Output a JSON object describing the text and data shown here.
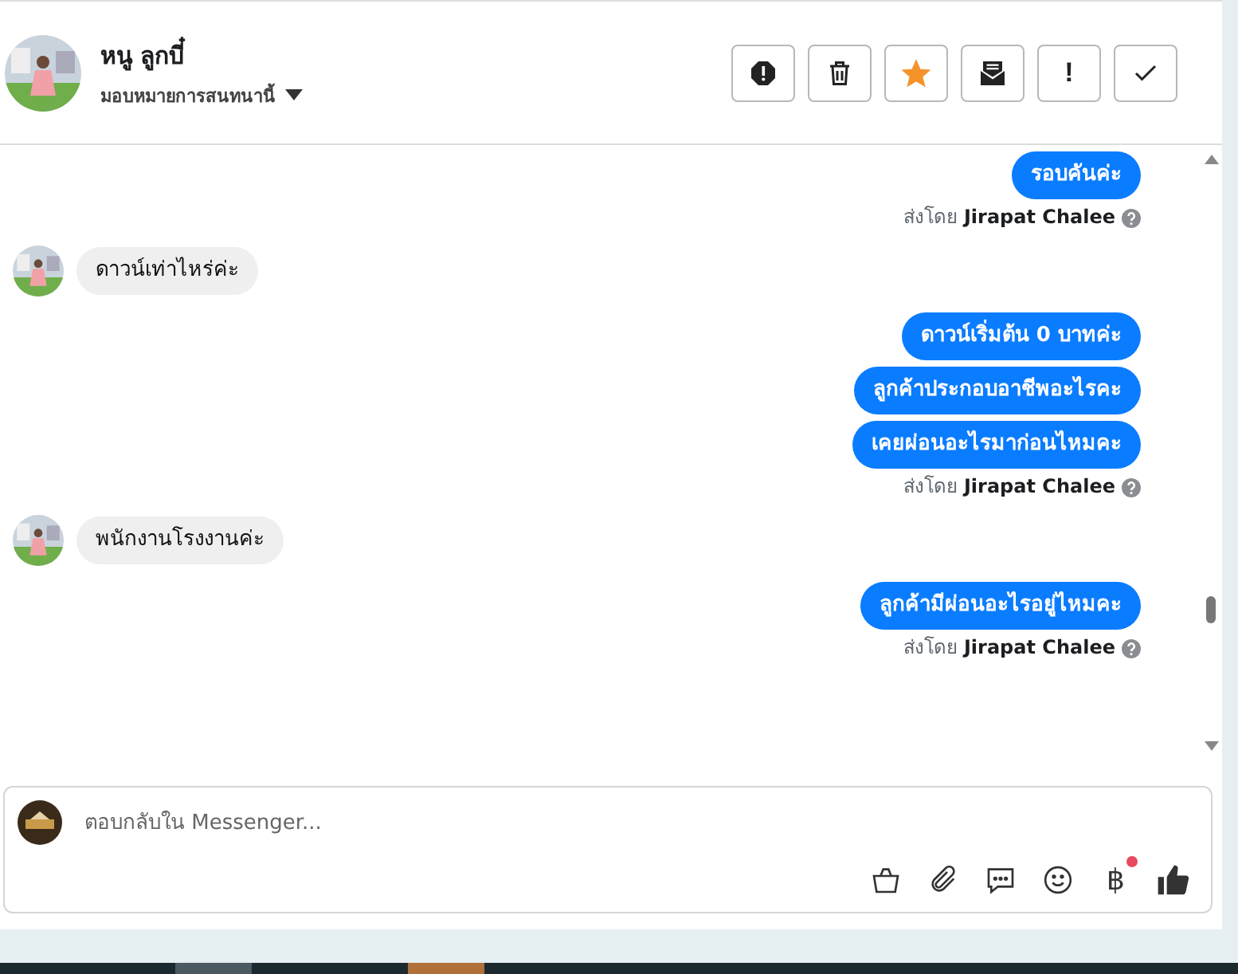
{
  "header": {
    "name": "หนู ลูกบี๋",
    "assignment": "มอบหมายการสนทนานี้"
  },
  "actions": [
    {
      "kind": "report"
    },
    {
      "kind": "trash"
    },
    {
      "kind": "star",
      "selected": true
    },
    {
      "kind": "mail"
    },
    {
      "kind": "text",
      "label": "!"
    },
    {
      "kind": "check"
    }
  ],
  "messages": [
    {
      "kind": "outgoing",
      "text": "รอบคันค่ะ"
    },
    {
      "kind": "note",
      "prefix": "ส่งโดย",
      "sender": "Jirapat Chalee"
    },
    {
      "kind": "incoming",
      "text": "ดาวน์เท่าไหร่ค่ะ"
    },
    {
      "kind": "outgoing",
      "text": "ดาวน์เริ่มต้น 0 บาทค่ะ"
    },
    {
      "kind": "outgoing",
      "text": "ลูกค้าประกอบอาชีพอะไรคะ"
    },
    {
      "kind": "outgoing",
      "text": "เคยผ่อนอะไรมาก่อนไหมคะ"
    },
    {
      "kind": "note",
      "prefix": "ส่งโดย",
      "sender": "Jirapat Chalee"
    },
    {
      "kind": "incoming",
      "text": "พนักงานโรงงานค่ะ"
    },
    {
      "kind": "outgoing",
      "text": "ลูกค้ามีผ่อนอะไรอยู่ไหมคะ"
    },
    {
      "kind": "note",
      "prefix": "ส่งโดย",
      "sender": "Jirapat Chalee"
    }
  ],
  "composer": {
    "placeholder": "ตอบกลับใน Messenger...",
    "tools": [
      {
        "kind": "basket"
      },
      {
        "kind": "clip"
      },
      {
        "kind": "chat"
      },
      {
        "kind": "smile"
      },
      {
        "kind": "baht",
        "label": "฿",
        "badge": true
      },
      {
        "kind": "like"
      }
    ]
  }
}
